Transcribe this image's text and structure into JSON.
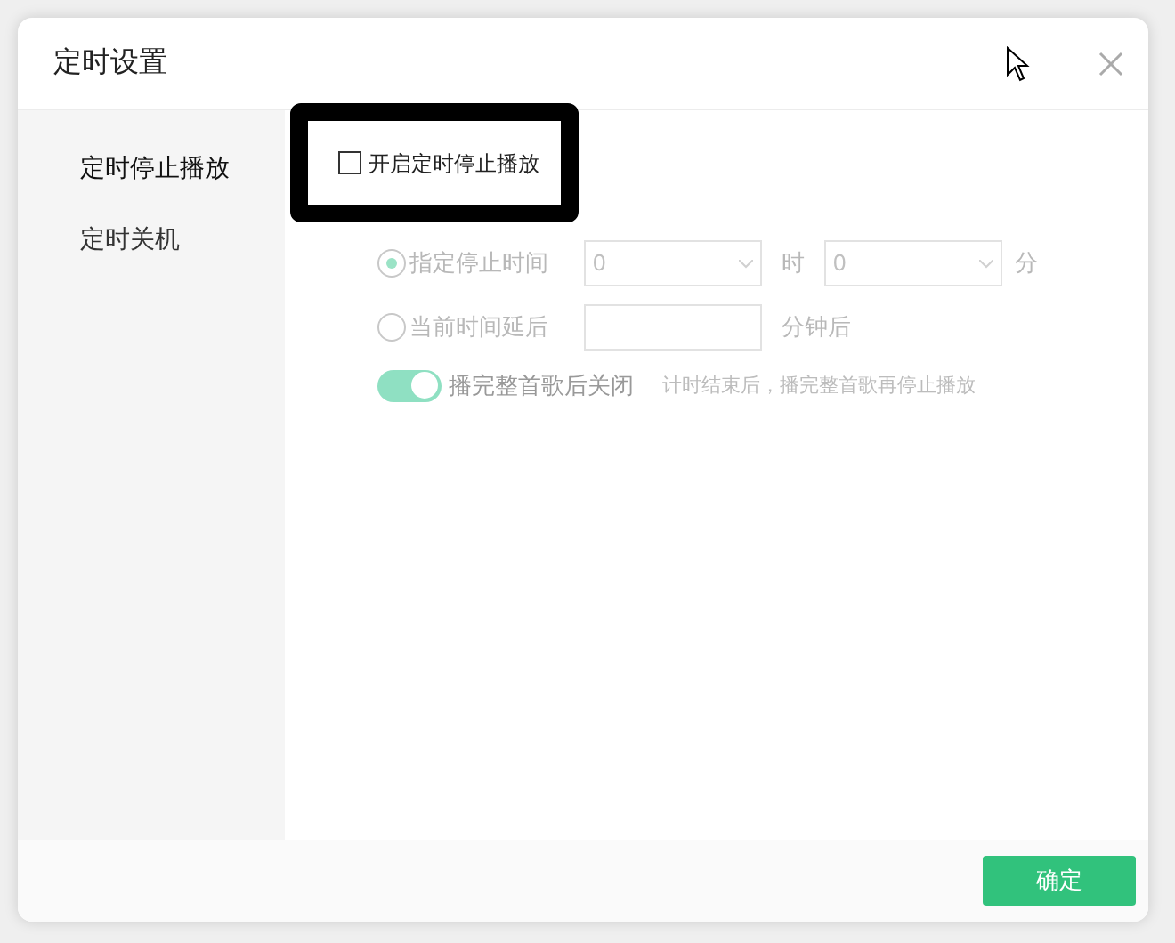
{
  "dialog": {
    "title": "定时设置"
  },
  "sidebar": {
    "items": [
      {
        "label": "定时停止播放",
        "selected": true
      },
      {
        "label": "定时关机",
        "selected": false
      }
    ]
  },
  "enable": {
    "label": "开启定时停止播放",
    "checked": false,
    "highlighted": true
  },
  "options": {
    "disabled": true,
    "specific": {
      "label": "指定停止时间",
      "selected": true,
      "hour": "0",
      "hour_unit": "时",
      "minute": "0",
      "minute_unit": "分"
    },
    "delay": {
      "label": "当前时间延后",
      "selected": false,
      "unit": "分钟后"
    },
    "finish_song": {
      "label": "播完整首歌后关闭",
      "on": true,
      "hint": "计时结束后，播完整首歌再停止播放"
    }
  },
  "footer": {
    "confirm": "确定"
  }
}
